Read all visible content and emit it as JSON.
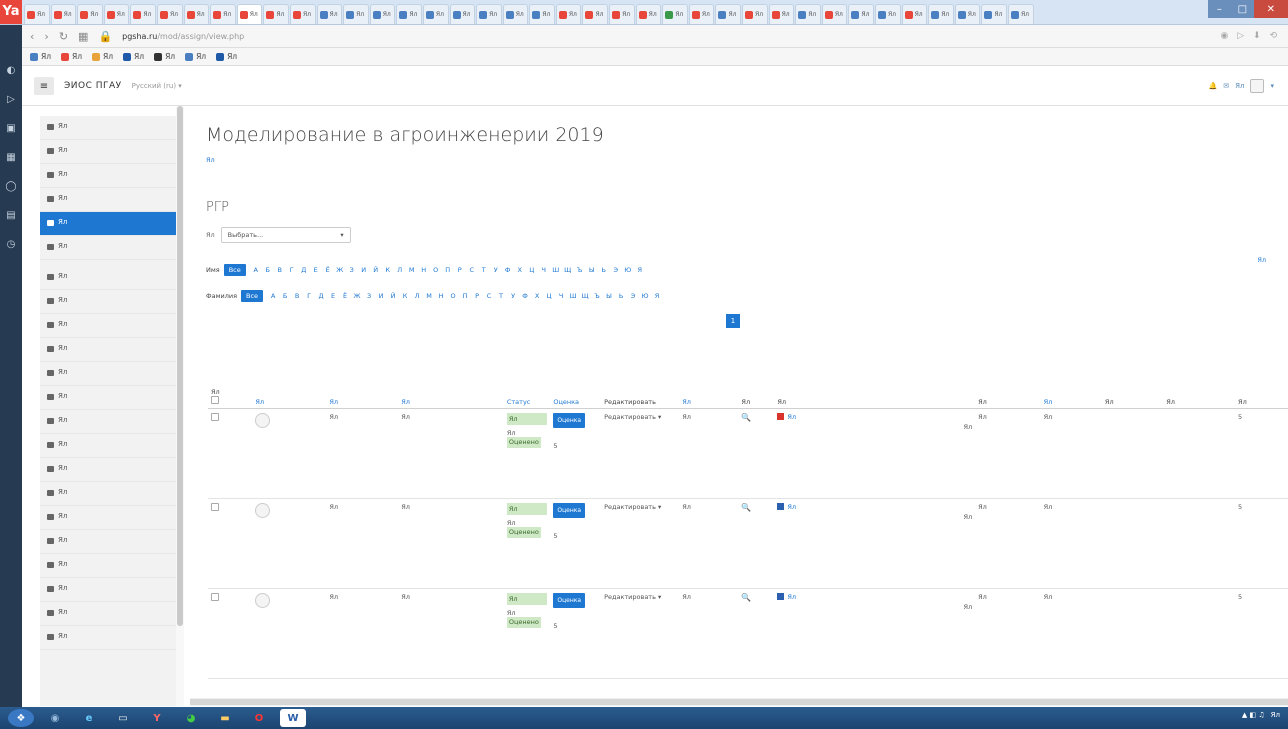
{
  "browser": {
    "logo": "Ya",
    "tabs": [
      {
        "label": "Ял",
        "color": "#e8463a"
      },
      {
        "label": "Ял",
        "color": "#e8463a"
      },
      {
        "label": "Ял",
        "color": "#e8463a"
      },
      {
        "label": "Ял",
        "color": "#e8463a"
      },
      {
        "label": "Ял",
        "color": "#e8463a"
      },
      {
        "label": "Ял",
        "color": "#e8463a"
      },
      {
        "label": "Ял",
        "color": "#e8463a"
      },
      {
        "label": "Ял",
        "color": "#e8463a"
      },
      {
        "label": "Ял",
        "color": "#e8463a"
      },
      {
        "label": "Ял",
        "color": "#e8463a"
      },
      {
        "label": "Ял",
        "color": "#e8463a"
      },
      {
        "label": "Ял",
        "color": "#4a7fc1"
      },
      {
        "label": "Ял",
        "color": "#4a7fc1"
      },
      {
        "label": "Ял",
        "color": "#4a7fc1"
      },
      {
        "label": "Ял",
        "color": "#4a7fc1"
      },
      {
        "label": "Ял",
        "color": "#4a7fc1"
      },
      {
        "label": "Ял",
        "color": "#4a7fc1"
      },
      {
        "label": "Ял",
        "color": "#4a7fc1"
      },
      {
        "label": "Ял",
        "color": "#4a7fc1"
      },
      {
        "label": "Ял",
        "color": "#4a7fc1"
      },
      {
        "label": "Ял",
        "color": "#e8463a"
      },
      {
        "label": "Ял",
        "color": "#e8463a"
      },
      {
        "label": "Ял",
        "color": "#e8463a"
      },
      {
        "label": "Ял",
        "color": "#e8463a"
      },
      {
        "label": "Ял",
        "color": "#3a9a4a"
      },
      {
        "label": "Ял",
        "color": "#e8463a"
      },
      {
        "label": "Ял",
        "color": "#4a7fc1"
      },
      {
        "label": "Ял",
        "color": "#e8463a"
      },
      {
        "label": "Ял",
        "color": "#e8463a"
      },
      {
        "label": "Ял",
        "color": "#4a7fc1"
      },
      {
        "label": "Ял",
        "color": "#e8463a"
      },
      {
        "label": "Ял",
        "color": "#4a7fc1"
      },
      {
        "label": "Ял",
        "color": "#4a7fc1"
      },
      {
        "label": "Ял",
        "color": "#e8463a"
      },
      {
        "label": "Ял",
        "color": "#4a7fc1"
      },
      {
        "label": "Ял",
        "color": "#4a7fc1"
      },
      {
        "label": "Ял",
        "color": "#4a7fc1"
      },
      {
        "label": "Ял",
        "color": "#4a7fc1"
      }
    ],
    "url_domain": "pgsha.ru",
    "url_rest": "/mod/assign/view.php",
    "bookmarks": [
      {
        "label": "Ял",
        "color": "#4a7fc1"
      },
      {
        "label": "Ял",
        "color": "#e8463a"
      },
      {
        "label": "Ял",
        "color": "#e8a33a"
      },
      {
        "label": "Ял",
        "color": "#1e5aa8"
      },
      {
        "label": "Ял",
        "color": "#333333"
      },
      {
        "label": "Ял",
        "color": "#4a7fc1"
      },
      {
        "label": "Ял",
        "color": "#1e5aa8"
      }
    ]
  },
  "navbar": {
    "site_name": "ЭИОС ПГАУ",
    "lang": "Русский (ru) ▾",
    "user": "Ял"
  },
  "sidebar": {
    "items": [
      {
        "label": "Ял",
        "active": false
      },
      {
        "label": "Ял",
        "active": false
      },
      {
        "label": "Ял",
        "active": false
      },
      {
        "label": "Ял",
        "active": false
      },
      {
        "label": "Ял",
        "active": true
      },
      {
        "label": "Ял",
        "active": false
      },
      {
        "label": "Ял",
        "active": false,
        "gap": true
      },
      {
        "label": "Ял",
        "active": false
      },
      {
        "label": "Ял",
        "active": false
      },
      {
        "label": "Ял",
        "active": false
      },
      {
        "label": "Ял",
        "active": false
      },
      {
        "label": "Ял",
        "active": false
      },
      {
        "label": "Ял",
        "active": false
      },
      {
        "label": "Ял",
        "active": false
      },
      {
        "label": "Ял",
        "active": false
      },
      {
        "label": "Ял",
        "active": false
      },
      {
        "label": "Ял",
        "active": false
      },
      {
        "label": "Ял",
        "active": false
      },
      {
        "label": "Ял",
        "active": false
      },
      {
        "label": "Ял",
        "active": false
      },
      {
        "label": "Ял",
        "active": false
      },
      {
        "label": "Ял",
        "active": false
      }
    ]
  },
  "main": {
    "course_title": "Моделирование в агроинженерии 2019",
    "breadcrumb": "Ял",
    "page_title": "РГР",
    "action_label": "Ял",
    "action_value": "Выбрать...",
    "reset_link": "Ял",
    "alpha_label_1": "Имя",
    "alpha_label_2": "Фамилия",
    "alpha_all": "Все",
    "letters": [
      "А",
      "Б",
      "В",
      "Г",
      "Д",
      "Е",
      "Ё",
      "Ж",
      "З",
      "И",
      "Й",
      "К",
      "Л",
      "М",
      "Н",
      "О",
      "П",
      "Р",
      "С",
      "Т",
      "У",
      "Ф",
      "Х",
      "Ц",
      "Ч",
      "Ш",
      "Щ",
      "Ъ",
      "Ы",
      "Ь",
      "Э",
      "Ю",
      "Я"
    ],
    "page_number": "1"
  },
  "table": {
    "headers": {
      "select": "Ял",
      "picture": "Ял",
      "name": "Ял",
      "email": "Ял",
      "status": "Статус",
      "grade": "Оценка",
      "edit": "Редактировать",
      "lastmod": "Ял",
      "text": "Ял",
      "file": "Ял",
      "comments": "Ял",
      "lastgrade": "Ял",
      "feedback": "Ял",
      "annot": "Ял",
      "final": "Ял"
    },
    "rows": [
      {
        "name": "Ял",
        "email": "Ял",
        "status1": "Ял",
        "status2": "Ял",
        "status2_ok": "Оценено",
        "grade_btn": "Оценка",
        "grade_val": "5",
        "edit": "Редактировать ▾",
        "lastmod": "Ял",
        "file": "Ял",
        "file_date": "Ял",
        "file_color": "#d9342b",
        "comments": "Ял",
        "lastgrade": "Ял",
        "final": "5"
      },
      {
        "name": "Ял",
        "email": "Ял",
        "status1": "Ял",
        "status2": "Ял",
        "status2_ok": "Оценено",
        "grade_btn": "Оценка",
        "grade_val": "5",
        "edit": "Редактировать ▾",
        "lastmod": "Ял",
        "file": "Ял",
        "file_date": "Ял",
        "file_color": "#2b5fb0",
        "comments": "Ял",
        "lastgrade": "Ял",
        "final": "5"
      },
      {
        "name": "Ял",
        "email": "Ял",
        "status1": "Ял",
        "status2": "Ял",
        "status2_ok": "Оценено",
        "grade_btn": "Оценка",
        "grade_val": "5",
        "edit": "Редактировать ▾",
        "lastmod": "Ял",
        "file": "Ял",
        "file_date": "Ял",
        "file_color": "#2b5fb0",
        "comments": "Ял",
        "lastgrade": "Ял",
        "final": "5"
      }
    ]
  },
  "taskbar": {
    "clock": "Ял"
  }
}
